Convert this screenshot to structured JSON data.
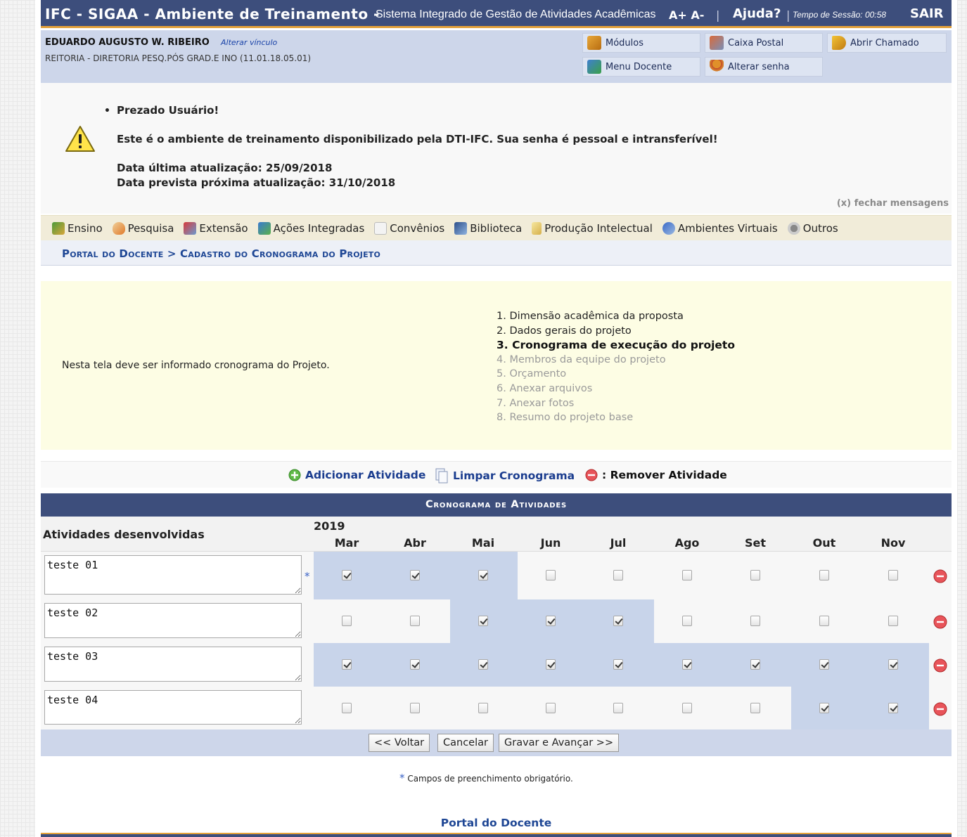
{
  "topbar": {
    "app_title": "IFC - SIGAA - Ambiente de Treinamento -",
    "system_name": "Sistema Integrado de Gestão de Atividades Acadêmicas",
    "font_controls": "A+ A-",
    "help": "Ajuda?",
    "session_label": "Tempo de Sessão: 00:58",
    "logout": "SAIR"
  },
  "user": {
    "name": "EDUARDO AUGUSTO W. RIBEIRO",
    "change_link": "Alterar vínculo",
    "unit": "REITORIA - DIRETORIA PESQ.PÓS GRAD.E INO (11.01.18.05.01)"
  },
  "quick_links": {
    "modulos": "Módulos",
    "caixa_postal": "Caixa Postal",
    "abrir_chamado": "Abrir Chamado",
    "menu_docente": "Menu Docente",
    "alterar_senha": "Alterar senha"
  },
  "message": {
    "greeting": "Prezado Usuário!",
    "line1": "Este é o ambiente de treinamento disponibilizado pela DTI-IFC. Sua senha é pessoal e intransferível!",
    "line2": "Data última atualização: 25/09/2018",
    "line3": "Data prevista próxima atualização: 31/10/2018",
    "close": "(x) fechar mensagens"
  },
  "menu": [
    "Ensino",
    "Pesquisa",
    "Extensão",
    "Ações Integradas",
    "Convênios",
    "Biblioteca",
    "Produção Intelectual",
    "Ambientes Virtuais",
    "Outros"
  ],
  "breadcrumb": "Portal do Docente > Cadastro do Cronograma do Projeto",
  "info": {
    "text": "Nesta tela deve ser informado cronograma do Projeto.",
    "steps": [
      "1. Dimensão acadêmica da proposta",
      "2. Dados gerais do projeto",
      "3. Cronograma de execução do projeto",
      "4. Membros da equipe do projeto",
      "5. Orçamento",
      "6. Anexar arquivos",
      "7. Anexar fotos",
      "8. Resumo do projeto base"
    ]
  },
  "actions": {
    "add": "Adicionar Atividade",
    "clear": "Limpar Cronograma",
    "remove": ": Remover Atividade"
  },
  "table": {
    "title": "Cronograma de Atividades",
    "col_activities": "Atividades desenvolvidas",
    "year": "2019",
    "months": [
      "Mar",
      "Abr",
      "Mai",
      "Jun",
      "Jul",
      "Ago",
      "Set",
      "Out",
      "Nov"
    ],
    "rows": [
      {
        "activity": "teste 01",
        "checked": [
          true,
          true,
          true,
          false,
          false,
          false,
          false,
          false,
          false
        ]
      },
      {
        "activity": "teste 02",
        "checked": [
          false,
          false,
          true,
          true,
          true,
          false,
          false,
          false,
          false
        ]
      },
      {
        "activity": "teste 03",
        "checked": [
          true,
          true,
          true,
          true,
          true,
          true,
          true,
          true,
          true
        ]
      },
      {
        "activity": "teste 04",
        "checked": [
          false,
          false,
          false,
          false,
          false,
          false,
          false,
          true,
          true
        ]
      }
    ]
  },
  "buttons": {
    "back": "<< Voltar",
    "cancel": "Cancelar",
    "save": "Gravar e Avançar >>"
  },
  "required_note": "Campos de preenchimento obrigatório.",
  "footer_link": "Portal do Docente"
}
